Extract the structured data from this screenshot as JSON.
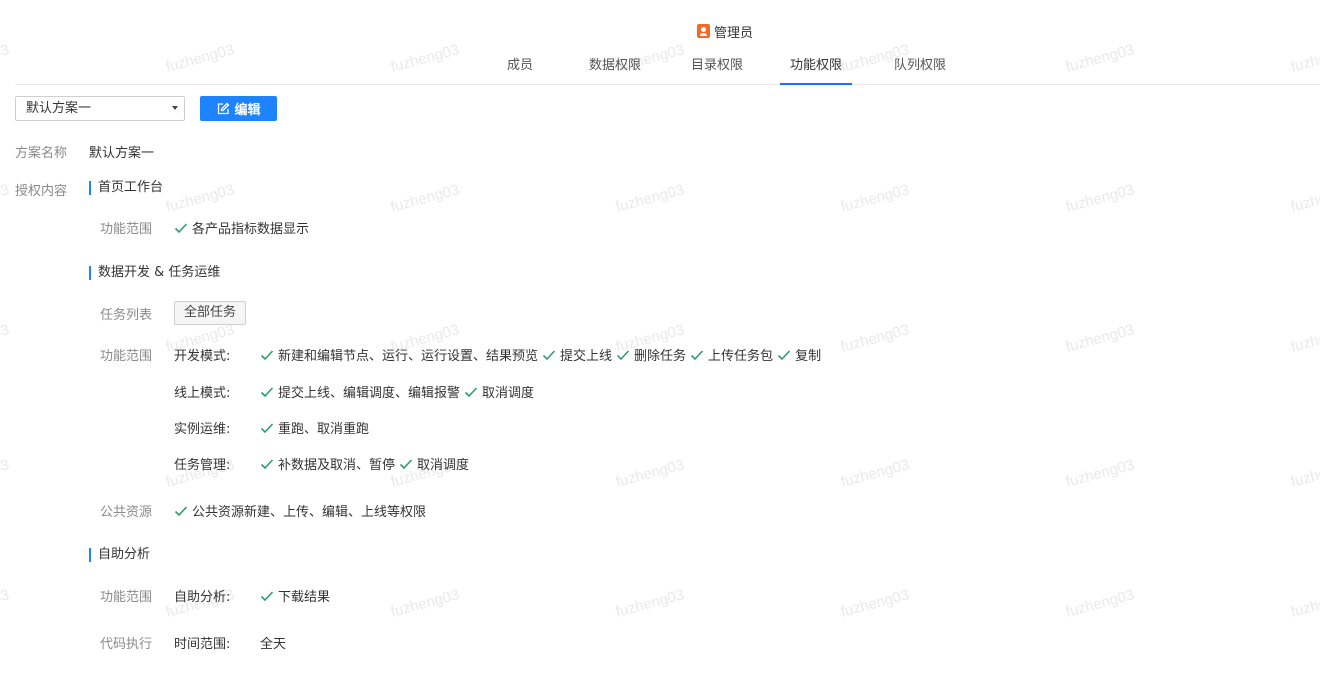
{
  "header": {
    "role_icon": "admin-badge-icon",
    "role_label": "管理员",
    "tabs": [
      {
        "label": "成员",
        "active": false
      },
      {
        "label": "数据权限",
        "active": false
      },
      {
        "label": "目录权限",
        "active": false
      },
      {
        "label": "功能权限",
        "active": true
      },
      {
        "label": "队列权限",
        "active": false
      }
    ],
    "accent_color": "#1d83ff"
  },
  "toolbar": {
    "scheme_select_value": "默认方案一",
    "edit_label": "编辑",
    "edit_icon": "edit-icon"
  },
  "scheme": {
    "name_label": "方案名称",
    "name_value": "默认方案一",
    "content_label": "授权内容"
  },
  "sections": {
    "home": {
      "title": "首页工作台",
      "scope_label": "功能范围",
      "scope_items": [
        "各产品指标数据显示"
      ]
    },
    "dev": {
      "title": "数据开发 & 任务运维",
      "task_list_label": "任务列表",
      "task_list_tag": "全部任务",
      "scope_label": "功能范围",
      "modes": [
        {
          "label": "开发模式:",
          "items": [
            "新建和编辑节点、运行、运行设置、结果预览",
            "提交上线",
            "删除任务",
            "上传任务包",
            "复制"
          ]
        },
        {
          "label": "线上模式:",
          "items": [
            "提交上线、编辑调度、编辑报警",
            "取消调度"
          ]
        },
        {
          "label": "实例运维:",
          "items": [
            "重跑、取消重跑"
          ]
        },
        {
          "label": "任务管理:",
          "items": [
            "补数据及取消、暂停",
            "取消调度"
          ]
        }
      ],
      "public_label": "公共资源",
      "public_items": [
        "公共资源新建、上传、编辑、上线等权限"
      ]
    },
    "analysis": {
      "title": "自助分析",
      "scope_label": "功能范围",
      "mode_label": "自助分析:",
      "items": [
        "下载结果"
      ],
      "code_label": "代码执行",
      "time_label": "时间范围:",
      "time_value": "全天"
    }
  },
  "check_icon": "check-icon",
  "check_color": "#2e9e6a",
  "watermark_text": "fuzheng03"
}
